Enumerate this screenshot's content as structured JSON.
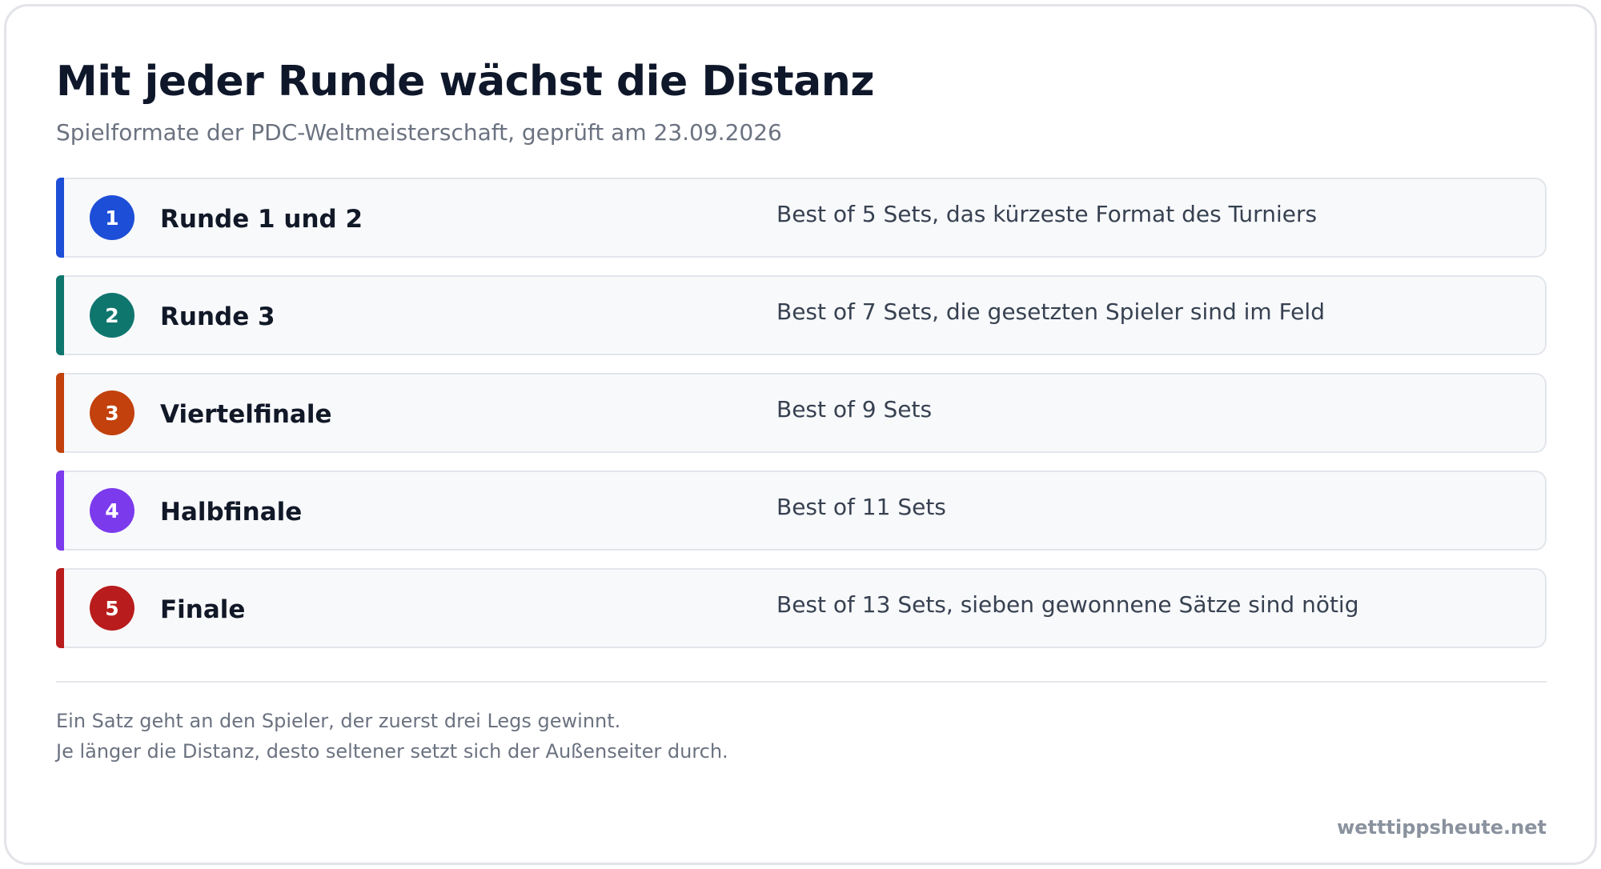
{
  "header": {
    "title": "Mit jeder Runde wächst die Distanz",
    "subtitle": "Spielformate der PDC-Weltmeisterschaft, geprüft am 23.09.2026"
  },
  "rounds": [
    {
      "number": "1",
      "name": "Runde 1 und 2",
      "format": "Best of 5 Sets, das kürzeste Format des Turniers",
      "color": "#1d4ed8"
    },
    {
      "number": "2",
      "name": "Runde 3",
      "format": "Best of 7 Sets, die gesetzten Spieler sind im Feld",
      "color": "#0f766e"
    },
    {
      "number": "3",
      "name": "Viertelfinale",
      "format": "Best of 9 Sets",
      "color": "#c2410c"
    },
    {
      "number": "4",
      "name": "Halbfinale",
      "format": "Best of 11 Sets",
      "color": "#7c3aed"
    },
    {
      "number": "5",
      "name": "Finale",
      "format": "Best of 13 Sets, sieben gewonnene Sätze sind nötig",
      "color": "#b91c1c"
    }
  ],
  "footer": {
    "notes": [
      "Ein Satz geht an den Spieler, der zuerst drei Legs gewinnt.",
      "Je länger die Distanz, desto seltener setzt sich der Außenseiter durch."
    ],
    "brand": "wetttippsheute.net"
  }
}
